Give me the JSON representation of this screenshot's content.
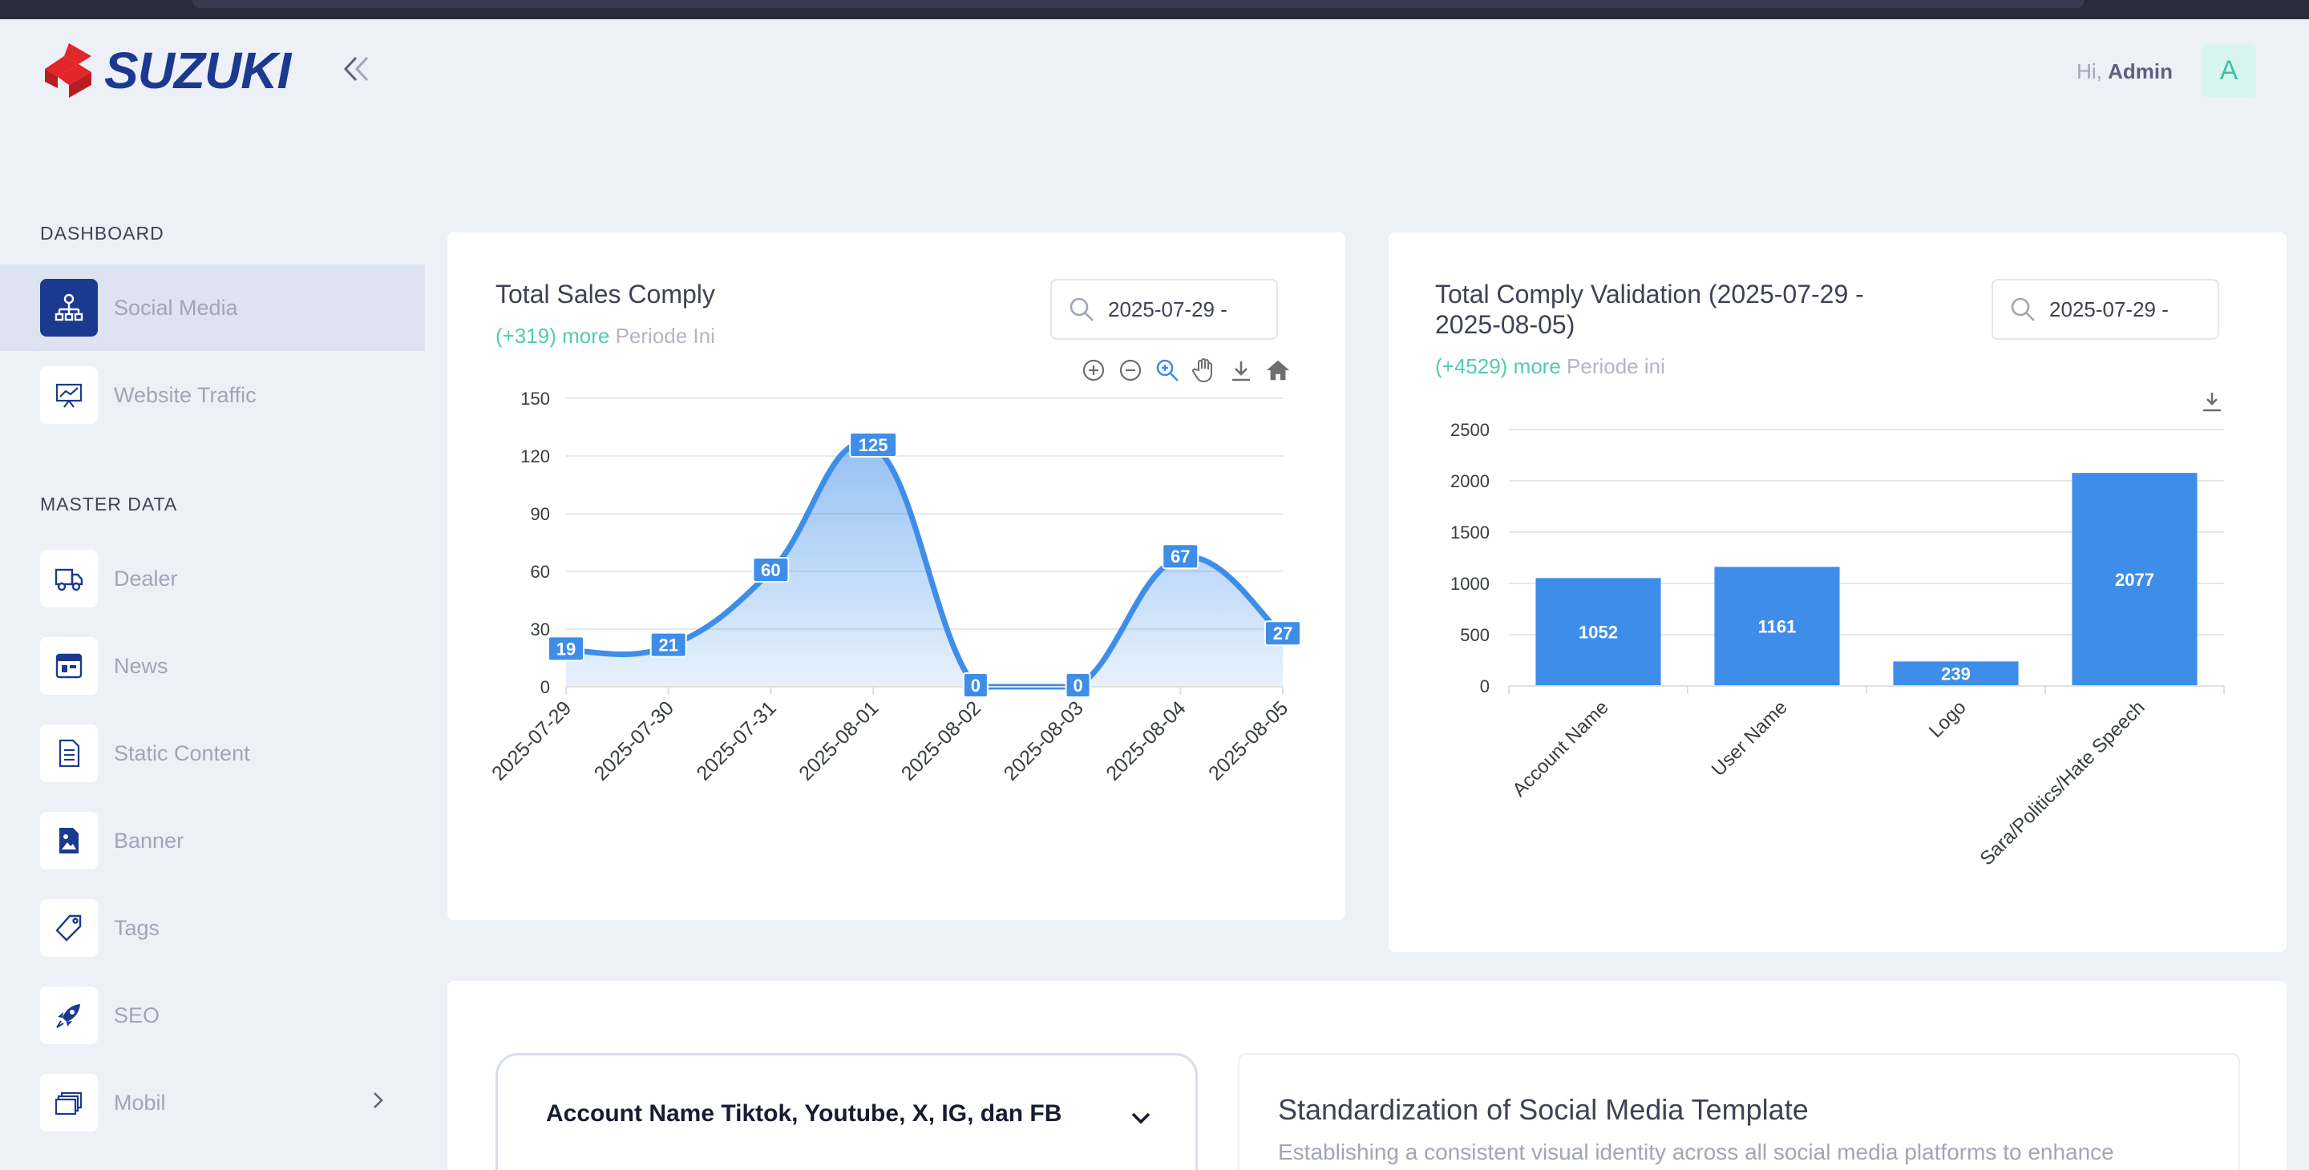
{
  "brand": {
    "name": "SUZUKI",
    "logo_color": "#e2262a",
    "text_color": "#1b3a8f"
  },
  "header": {
    "greeting": "Hi,",
    "user_name": "Admin",
    "avatar_letter": "A"
  },
  "sidebar": {
    "sections": [
      {
        "title": "DASHBOARD",
        "items": [
          {
            "label": "Social Media",
            "icon": "sitemap-icon",
            "active": true
          },
          {
            "label": "Website Traffic",
            "icon": "presentation-chart-icon"
          }
        ]
      },
      {
        "title": "MASTER DATA",
        "items": [
          {
            "label": "Dealer",
            "icon": "truck-icon"
          },
          {
            "label": "News",
            "icon": "calendar-news-icon"
          },
          {
            "label": "Static Content",
            "icon": "document-icon"
          },
          {
            "label": "Banner",
            "icon": "image-file-icon"
          },
          {
            "label": "Tags",
            "icon": "tag-icon"
          },
          {
            "label": "SEO",
            "icon": "rocket-icon"
          },
          {
            "label": "Mobil",
            "icon": "gallery-icon",
            "has_submenu": true
          }
        ]
      }
    ]
  },
  "sales_card": {
    "title": "Total Sales Comply",
    "delta": "(+319) more",
    "period": "Periode Ini",
    "search_value": "2025-07-29 -"
  },
  "validation_card": {
    "title_line1": "Total Comply Validation (2025-07-29 -",
    "title_line2": "2025-08-05)",
    "delta": "(+4529) more",
    "period": "Periode ini",
    "search_value": "2025-07-29 -"
  },
  "chart_data": [
    {
      "type": "area",
      "title": "Total Sales Comply",
      "x": [
        "2025-07-29",
        "2025-07-30",
        "2025-07-31",
        "2025-08-01",
        "2025-08-02",
        "2025-08-03",
        "2025-08-04",
        "2025-08-05"
      ],
      "values": [
        19,
        21,
        60,
        125,
        0,
        0,
        67,
        27
      ],
      "yticks": [
        0,
        30,
        60,
        90,
        120,
        150
      ],
      "ylim": [
        0,
        150
      ],
      "grid": true,
      "color": "#3e8ee9"
    },
    {
      "type": "bar",
      "title": "Total Comply Validation (2025-07-29 - 2025-08-05)",
      "categories": [
        "Account Name",
        "User Name",
        "Logo",
        "Sara/Politics/Hate Speech"
      ],
      "values": [
        1052,
        1161,
        239,
        2077
      ],
      "yticks": [
        0,
        500,
        1000,
        1500,
        2000,
        2500
      ],
      "ylim": [
        0,
        2500
      ],
      "grid": true,
      "color": "#3e8ee9"
    }
  ],
  "bottom": {
    "accordion_title": "Account Name Tiktok, Youtube, X, IG, dan FB",
    "std_title": "Standardization of Social Media Template",
    "std_desc": "Establishing a consistent visual identity across all social media platforms to enhance"
  }
}
